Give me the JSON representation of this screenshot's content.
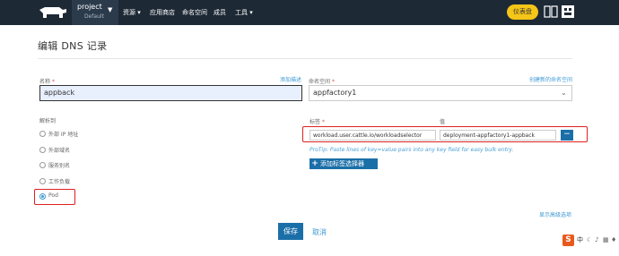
{
  "nav": {
    "project_name": "project",
    "project_sub": "Default",
    "items": [
      "资源 ▾",
      "应用商店",
      "命名空间",
      "成员",
      "工具 ▾"
    ],
    "dashboard_label": "仪表盘"
  },
  "page": {
    "title": "编辑 DNS 记录"
  },
  "form": {
    "name_label": "名称",
    "name_value": "appback",
    "add_desc_link": "添加描述",
    "ns_label": "命名空间",
    "ns_value": "appfactory1",
    "create_ns_link": "创建新的命名空间",
    "resolve_label": "解析到",
    "options": [
      "外部 IP 地址",
      "外部域名",
      "服务别名",
      "工作负载",
      "Pod"
    ],
    "selected_option": "Pod",
    "labels_header": "标签",
    "value_header": "值",
    "label_key": "workload.user.cattle.io/workloadselector",
    "label_value": "deployment-appfactory1-appback",
    "remove_label": "−",
    "protip": "ProTip: Paste lines of key=value pairs into any key field for easy bulk entry.",
    "add_selector_label": "添加标签选择器",
    "advanced_link": "显示高级选项",
    "save_label": "保存",
    "cancel_label": "取消",
    "required_mark": "*"
  },
  "ime": {
    "brand": "S",
    "lang": "中",
    "icons": [
      "moon-icon",
      "mic-icon",
      "keyboard-icon",
      "tshirt-icon"
    ]
  }
}
